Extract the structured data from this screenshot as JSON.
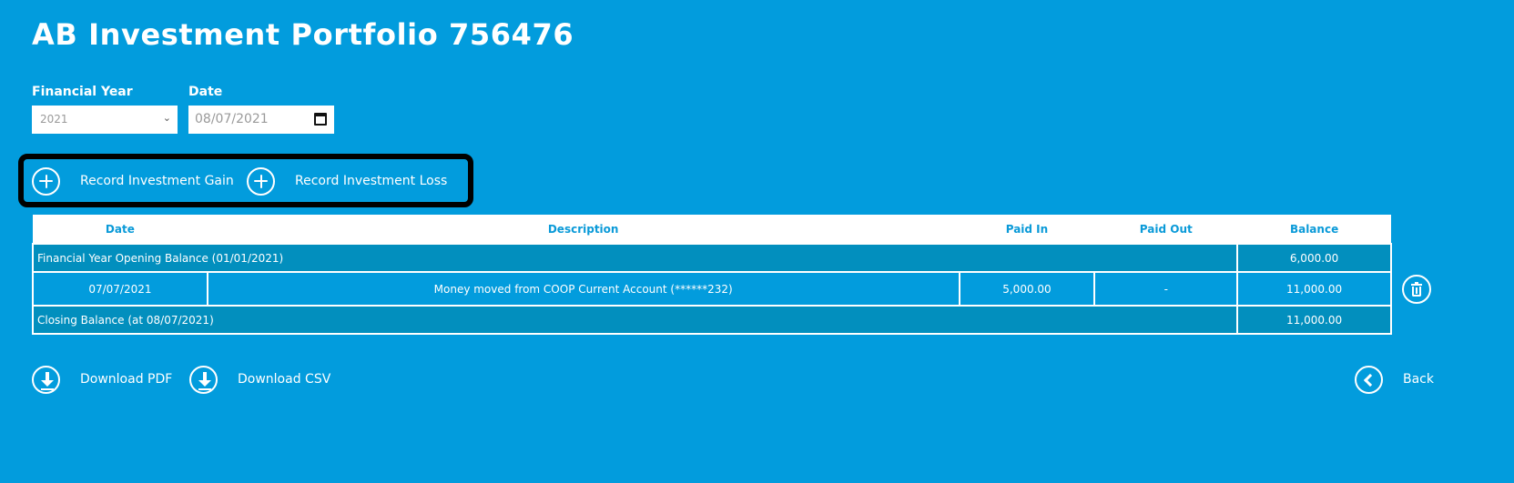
{
  "header": {
    "title": "AB Investment Portfolio 756476"
  },
  "filters": {
    "financial_year_label": "Financial Year",
    "financial_year_value": "2021",
    "date_label": "Date",
    "date_value": "08/07/2021"
  },
  "actions": {
    "gain_label": "Record Investment Gain",
    "loss_label": "Record Investment Loss"
  },
  "table": {
    "columns": [
      "Date",
      "Description",
      "Paid In",
      "Paid Out",
      "Balance"
    ],
    "opening": {
      "label": "Financial Year Opening Balance (01/01/2021)",
      "balance": "6,000.00"
    },
    "rows": [
      {
        "date": "07/07/2021",
        "description": "Money moved from COOP Current Account (******232)",
        "paid_in": "5,000.00",
        "paid_out": "-",
        "balance": "11,000.00"
      }
    ],
    "closing": {
      "label": "Closing Balance (at 08/07/2021)",
      "balance": "11,000.00"
    }
  },
  "footer": {
    "download_pdf_label": "Download PDF",
    "download_csv_label": "Download CSV",
    "back_label": "Back"
  },
  "colors": {
    "background": "#029cdd",
    "summary_row": "#028fbe",
    "header_text": "#0a9ad8",
    "highlight_frame": "#000000"
  },
  "icons": [
    "plus-circle-icon",
    "calendar-icon",
    "chevron-down-icon",
    "trash-icon",
    "download-icon",
    "chevron-left-icon"
  ]
}
